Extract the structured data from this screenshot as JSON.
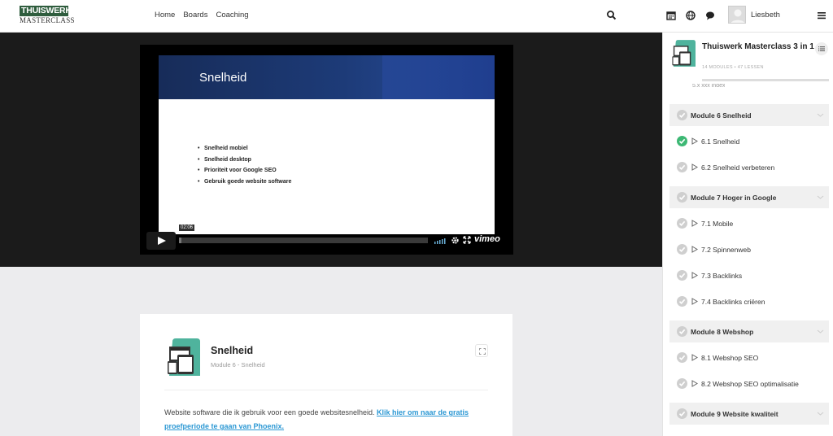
{
  "brand": {
    "logo_top": "THUISWERK",
    "logo_bottom": "MASTERCLASS"
  },
  "nav": [
    {
      "label": "Home"
    },
    {
      "label": "Boards"
    },
    {
      "label": "Coaching"
    }
  ],
  "user": {
    "name": "Liesbeth"
  },
  "video": {
    "slide_title": "Snelheid",
    "bullets": [
      "Snelheid mobiel",
      "Snelheid desktop",
      "Prioriteit voor Google SEO",
      "Gebruik goede website software"
    ],
    "time": "02:06",
    "progress": 0.01,
    "player_brand": "vimeo"
  },
  "lesson": {
    "title": "Snelheid",
    "subtitle": "Module 6 - Snelheid",
    "body_text": "Website software die ik gebruik voor een goede websitesnelheid. ",
    "link_text": "Klik hier om naar de gratis proefperiode te gaan van Phoenix."
  },
  "sidebar": {
    "course_title": "Thuiswerk Masterclass 3 in 1",
    "course_meta": "14 MODULES  •  47 LESSEN",
    "cut_item": "5.x xxx index",
    "items": [
      {
        "type": "module",
        "label": "Module 6   Snelheid"
      },
      {
        "type": "lesson",
        "label": "6.1 Snelheid",
        "done": true
      },
      {
        "type": "lesson",
        "label": "6.2 Snelheid verbeteren",
        "done": false
      },
      {
        "type": "module",
        "label": "Module 7   Hoger in Google"
      },
      {
        "type": "lesson",
        "label": "7.1 Mobile",
        "done": false
      },
      {
        "type": "lesson",
        "label": "7.2 Spinnenweb",
        "done": false
      },
      {
        "type": "lesson",
        "label": "7.3 Backlinks",
        "done": false
      },
      {
        "type": "lesson",
        "label": "7.4 Backlinks criëren",
        "done": false
      },
      {
        "type": "module",
        "label": "Module 8   Webshop"
      },
      {
        "type": "lesson",
        "label": "8.1 Webshop SEO",
        "done": false
      },
      {
        "type": "lesson",
        "label": "8.2 Webshop SEO optimalisatie",
        "done": false
      },
      {
        "type": "module",
        "label": "Module 9   Website kwaliteit"
      }
    ]
  },
  "colors": {
    "brand_green": "#2f5d3e",
    "done_green": "#3db874",
    "link_blue": "#2c98d4",
    "teal": "#4fb39d"
  },
  "icons": [
    "search-icon",
    "calendar-icon",
    "globe-icon",
    "chat-icon",
    "menu-icon",
    "play-icon",
    "volume-icon",
    "gear-icon",
    "fullscreen-icon",
    "expand-icon",
    "list-icon",
    "check-icon",
    "chevron-down-icon"
  ]
}
